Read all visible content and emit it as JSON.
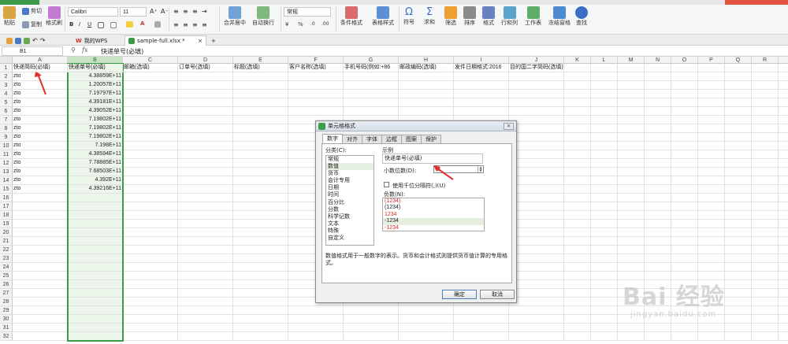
{
  "ribbon": {
    "paste_label": "粘贴",
    "cut_label": "剪切",
    "copy_label": "复制",
    "format_painter_label": "格式刷",
    "font_name": "Calibri",
    "font_size": "11",
    "merge_center_label": "合并居中",
    "wrap_text_label": "自动换行",
    "number_format": "常规",
    "currency_symbol": "¥",
    "percent_symbol": "%",
    "conditional_format_label": "条件格式",
    "table_style_label": "表格样式",
    "symbol_label": "符号",
    "sum_label": "求和",
    "filter_label": "筛选",
    "sort_label": "排序",
    "format_label": "格式",
    "row_col_label": "行和列",
    "worksheet_label": "工作表",
    "freeze_label": "冻结窗格",
    "find_label": "查找"
  },
  "tabs": {
    "wps_label": "我的WPS",
    "file_label": "sample-full.xlsx *",
    "add_label": "+"
  },
  "formula_bar": {
    "cell_ref": "B1",
    "fx": "fx",
    "content": "快递单号(必填)"
  },
  "columns": [
    "A",
    "B",
    "C",
    "D",
    "E",
    "F",
    "G",
    "H",
    "I",
    "J",
    "K",
    "L",
    "M",
    "N",
    "O",
    "P",
    "Q",
    "R",
    "S"
  ],
  "header_row": [
    "快递简码(必填)",
    "快递单号(必填)",
    "邮箱(选填)",
    "订单号(选填)",
    "标题(选填)",
    "客户名称(选填)",
    "手机号码(例如:+86",
    "邮政编码(选填)",
    "发件日期格式:2016",
    "目的国二字简码(选填)"
  ],
  "data_rows": [
    [
      "zto",
      "4.38859E+11"
    ],
    [
      "zto",
      "1.20057E+11"
    ],
    [
      "zto",
      "7.19797E+11"
    ],
    [
      "zto",
      "4.39181E+11"
    ],
    [
      "zto",
      "4.39052E+11"
    ],
    [
      "zto",
      "7.19802E+11"
    ],
    [
      "zto",
      "7.19802E+11"
    ],
    [
      "zto",
      "7.19802E+11"
    ],
    [
      "zto",
      "7.198E+11"
    ],
    [
      "zto",
      "4.38594E+11"
    ],
    [
      "zto",
      "7.78885E+11"
    ],
    [
      "zto",
      "7.68503E+11"
    ],
    [
      "zto",
      "4.392E+11"
    ],
    [
      "zto",
      "4.39216E+11"
    ]
  ],
  "row_numbers": [
    "1",
    "2",
    "3",
    "4",
    "5",
    "6",
    "7",
    "8",
    "9",
    "10",
    "11",
    "12",
    "13",
    "14",
    "15",
    "16",
    "17",
    "18",
    "19",
    "20",
    "21",
    "22",
    "23",
    "24",
    "25",
    "26",
    "27",
    "28",
    "29",
    "30",
    "31",
    "32"
  ],
  "dialog": {
    "title": "单元格格式",
    "close": "×",
    "tabs": [
      "数字",
      "对齐",
      "字体",
      "边框",
      "图案",
      "保护"
    ],
    "category_label": "分类(C):",
    "categories": [
      "常规",
      "数值",
      "货币",
      "会计专用",
      "日期",
      "时间",
      "百分比",
      "分数",
      "科学记数",
      "文本",
      "特殊",
      "自定义"
    ],
    "selected_category": "数值",
    "sample_label": "示例",
    "sample_value": "快递单号(必填)",
    "decimal_label": "小数位数(D):",
    "decimal_value": "0",
    "thousands_label": "使用千位分隔符(,)(U)",
    "negative_label": "负数(N):",
    "negative_options": [
      "(1234)",
      "(1234)",
      "1234",
      "-1234",
      "-1234"
    ],
    "description": "数值格式用于一般数字的表示。货币和会计格式则提供货币值计算的专用格式。",
    "ok_label": "确定",
    "cancel_label": "取消"
  },
  "colors": {
    "accent_green": "#3b9a45",
    "header_selected": "#c9e4c5",
    "annotation_red": "#e0312a",
    "negative_red": "#d42a2a"
  },
  "watermark": {
    "logo": "Bai 经验",
    "url": "jingyan.baidu.com"
  }
}
